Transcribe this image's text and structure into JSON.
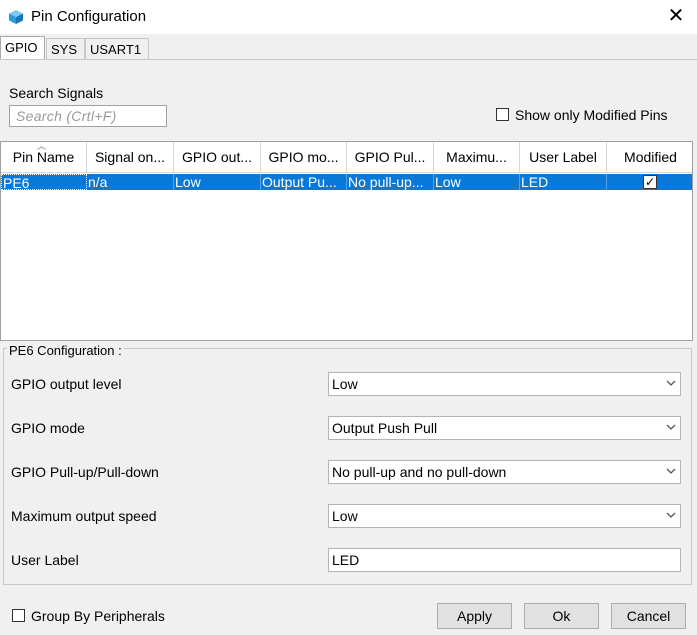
{
  "window": {
    "title": "Pin Configuration"
  },
  "tabs": [
    {
      "label": "GPIO",
      "active": true
    },
    {
      "label": "SYS",
      "active": false
    },
    {
      "label": "USART1",
      "active": false
    }
  ],
  "search": {
    "label": "Search Signals",
    "placeholder": "Search (Crtl+F)",
    "value": ""
  },
  "show_modified": {
    "label": "Show only Modified Pins",
    "checked": false
  },
  "table": {
    "columns": [
      "Pin Name",
      "Signal on...",
      "GPIO out...",
      "GPIO mo...",
      "GPIO Pul...",
      "Maximu...",
      "User Label",
      "Modified"
    ],
    "rows": [
      {
        "pin": "PE6",
        "signal": "n/a",
        "gpio_out": "Low",
        "gpio_mode": "Output Pu...",
        "gpio_pull": "No pull-up...",
        "max": "Low",
        "user_label": "LED",
        "modified": true
      }
    ]
  },
  "config": {
    "title": "PE6 Configuration :",
    "fields": {
      "output_level": {
        "label": "GPIO output level",
        "value": "Low"
      },
      "mode": {
        "label": "GPIO mode",
        "value": "Output Push Pull"
      },
      "pull": {
        "label": "GPIO Pull-up/Pull-down",
        "value": "No pull-up and no pull-down"
      },
      "speed": {
        "label": "Maximum output speed",
        "value": "Low"
      },
      "user_label": {
        "label": "User Label",
        "value": "LED"
      }
    }
  },
  "footer": {
    "group_by": {
      "label": "Group By Peripherals",
      "checked": false
    },
    "apply": "Apply",
    "ok": "Ok",
    "cancel": "Cancel"
  },
  "colors": {
    "selection": "#0a78d7",
    "background": "#f0f0f0"
  }
}
